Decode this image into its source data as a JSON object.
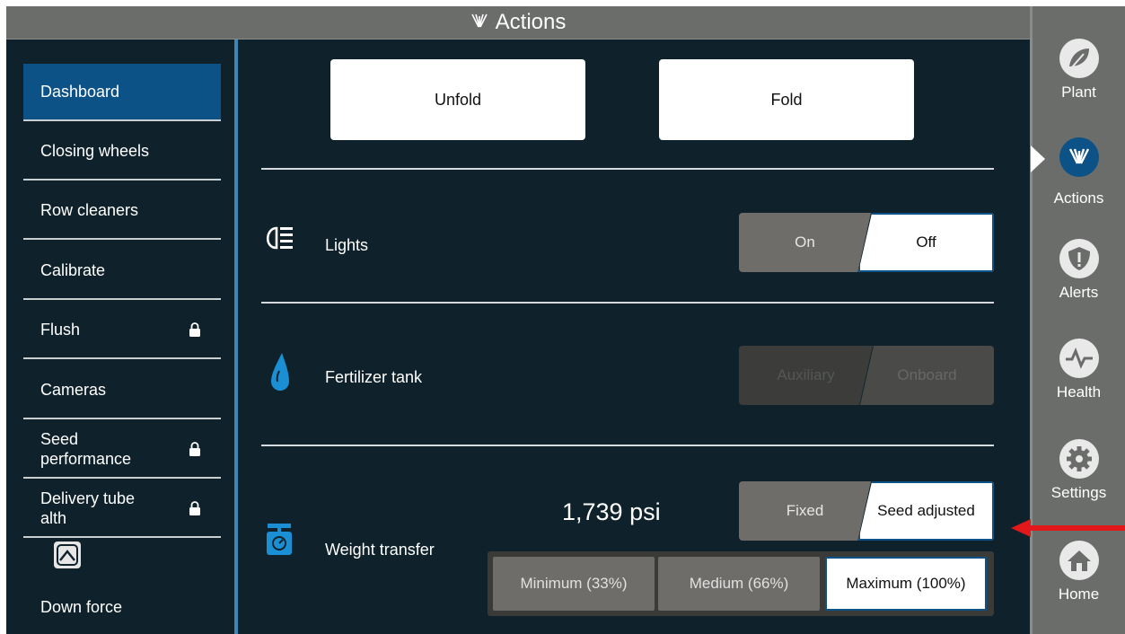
{
  "title": "Actions",
  "nav": {
    "items": [
      {
        "label": "Dashboard",
        "locked": false,
        "active": true
      },
      {
        "label": "Closing wheels",
        "locked": false
      },
      {
        "label": "Row cleaners",
        "locked": false
      },
      {
        "label": "Calibrate",
        "locked": false
      },
      {
        "label": "Flush",
        "locked": true
      },
      {
        "label": "Cameras",
        "locked": false
      },
      {
        "label": "Seed\nperformance",
        "locked": true
      },
      {
        "label": "Delivery tube\nalth",
        "locked": true
      },
      {
        "label": "Down force",
        "locked": false
      }
    ]
  },
  "main": {
    "unfold_label": "Unfold",
    "fold_label": "Fold",
    "lights": {
      "label": "Lights",
      "on": "On",
      "off": "Off",
      "selected": "Off"
    },
    "fertilizer": {
      "label": "Fertilizer tank",
      "aux": "Auxiliary",
      "onboard": "Onboard",
      "disabled": true
    },
    "weight": {
      "label": "Weight transfer",
      "pressure": "1,739 psi",
      "fixed": "Fixed",
      "seed_adjusted": "Seed adjusted",
      "selected_mode": "Seed adjusted",
      "levels": [
        "Minimum (33%)",
        "Medium (66%)",
        "Maximum (100%)"
      ],
      "selected_level": "Maximum (100%)"
    }
  },
  "rail": {
    "items": [
      {
        "label": "Plant",
        "icon": "plant-icon"
      },
      {
        "label": "Actions",
        "icon": "actions-icon",
        "active": true
      },
      {
        "label": "Alerts",
        "icon": "alerts-icon"
      },
      {
        "label": "Health",
        "icon": "health-icon"
      },
      {
        "label": "Settings",
        "icon": "settings-icon"
      },
      {
        "label": "Home",
        "icon": "home-icon"
      }
    ]
  },
  "colors": {
    "background": "#0f222b",
    "active_blue": "#0d5286",
    "rail_gray": "#6b6d6b",
    "water_blue": "#1a8fd4",
    "arrow_red": "#e3181b"
  }
}
